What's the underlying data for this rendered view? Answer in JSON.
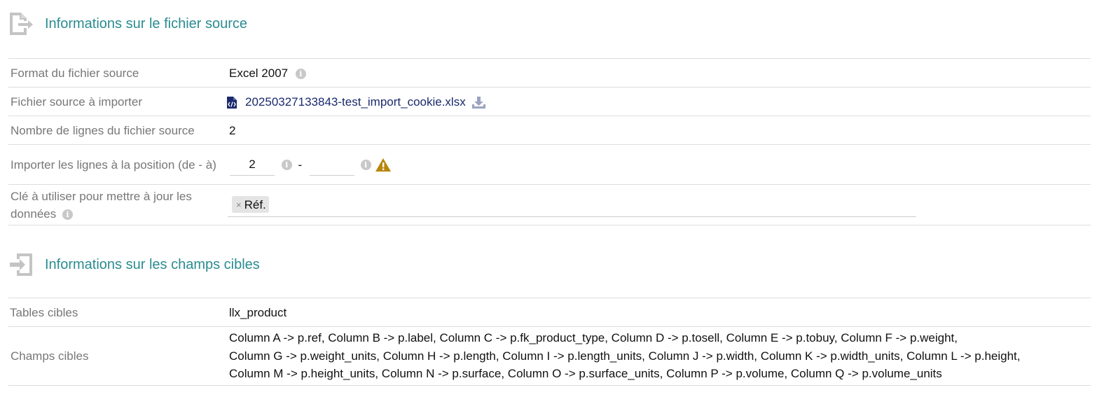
{
  "source_section": {
    "title": "Informations sur le fichier source",
    "rows": {
      "format": {
        "label": "Format du fichier source",
        "value": "Excel 2007"
      },
      "file": {
        "label": "Fichier source à importer",
        "value": "20250327133843-test_import_cookie.xlsx"
      },
      "line_count": {
        "label": "Nombre de lignes du fichier source",
        "value": "2"
      },
      "import_range": {
        "label": "Importer les lignes à la position (de - à)",
        "from": "2",
        "separator": "-",
        "to": ""
      },
      "update_key": {
        "label": "Clé à utiliser pour mettre à jour les données",
        "tag": "Réf.",
        "remove_glyph": "×"
      }
    }
  },
  "target_section": {
    "title": "Informations sur les champs cibles",
    "rows": {
      "tables": {
        "label": "Tables cibles",
        "value": "llx_product"
      },
      "fields": {
        "label": "Champs cibles",
        "lines": [
          "Column A -> p.ref, Column B -> p.label, Column C -> p.fk_product_type, Column D -> p.tosell, Column E -> p.tobuy, Column F -> p.weight,",
          "Column G -> p.weight_units, Column H -> p.length, Column I -> p.length_units, Column J -> p.width, Column K -> p.width_units, Column L -> p.height,",
          "Column M -> p.height_units, Column N -> p.surface, Column O -> p.surface_units, Column P -> p.volume, Column Q -> p.volume_units"
        ]
      }
    }
  },
  "icons": {
    "section_source": "file-export-icon",
    "section_target": "sign-in-icon",
    "info": "info-circle-icon",
    "file_type": "file-code-icon",
    "download": "download-icon",
    "warning": "warning-icon"
  },
  "colors": {
    "section_title": "#2b8c90",
    "label": "#777777",
    "warning": "#b8860b",
    "file_link": "#1a2a6c"
  }
}
